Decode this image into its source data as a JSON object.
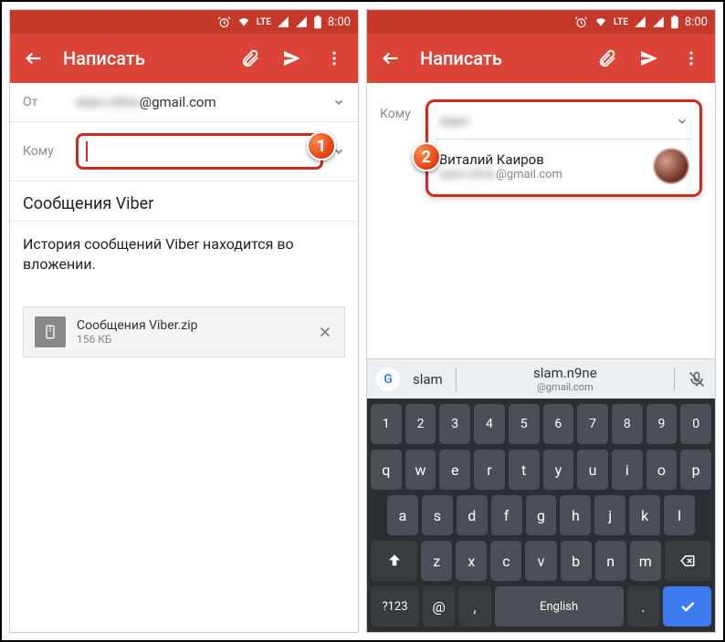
{
  "status": {
    "time": "8:00",
    "lte": "LTE"
  },
  "appbar": {
    "title": "Написать"
  },
  "left": {
    "from_label": "От",
    "from_prefix_blur": "slam.n9ne",
    "from_domain": "@gmail.com",
    "to_label": "Кому",
    "subject": "Сообщения Viber",
    "body": "История сообщений Viber находится во вложении.",
    "attachment": {
      "name": "Сообщения Viber.zip",
      "size": "156 КБ"
    },
    "step": "1"
  },
  "right": {
    "to_label": "Кому",
    "typed_blur": "slam",
    "contact": {
      "name": "Виталий Каиров",
      "email_prefix_blur": "slam.n9ne",
      "email_domain": "@gmail.com"
    },
    "step": "2"
  },
  "kb": {
    "g": "G",
    "sug1": "slam",
    "sug2_top": "slam.n9ne",
    "sug2_bot": "@gmail.com",
    "row0": [
      "1",
      "2",
      "3",
      "4",
      "5",
      "6",
      "7",
      "8",
      "9",
      "0"
    ],
    "row1": [
      "q",
      "w",
      "e",
      "r",
      "t",
      "y",
      "u",
      "i",
      "o",
      "p"
    ],
    "row2": [
      "a",
      "s",
      "d",
      "f",
      "g",
      "h",
      "j",
      "k",
      "l"
    ],
    "row3": [
      "z",
      "x",
      "c",
      "v",
      "b",
      "n",
      "m"
    ],
    "sym": "?123",
    "lang": "English",
    "comma": ",",
    "dot": "."
  }
}
